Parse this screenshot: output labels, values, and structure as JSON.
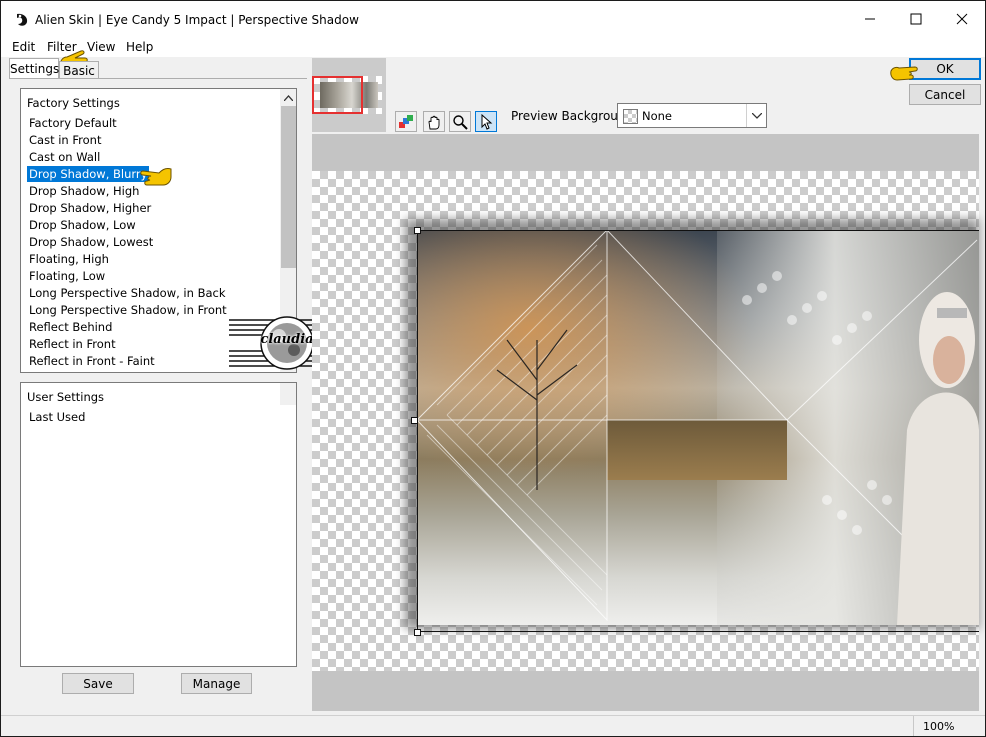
{
  "window": {
    "title": "Alien Skin | Eye Candy 5 Impact | Perspective Shadow"
  },
  "menu": {
    "items": [
      "Edit",
      "Filter",
      "View",
      "Help"
    ]
  },
  "tabs": {
    "settings": "Settings",
    "basic": "Basic"
  },
  "factory": {
    "header": "Factory Settings",
    "items": [
      "Factory Default",
      "Cast in Front",
      "Cast on Wall",
      "Drop Shadow, Blurry",
      "Drop Shadow, High",
      "Drop Shadow, Higher",
      "Drop Shadow, Low",
      "Drop Shadow, Lowest",
      "Floating, High",
      "Floating, Low",
      "Long Perspective Shadow, in Back",
      "Long Perspective Shadow, in Front",
      "Reflect Behind",
      "Reflect in Front",
      "Reflect in Front - Faint"
    ],
    "selected": "Drop Shadow, Blurry"
  },
  "user": {
    "header": "User Settings",
    "items": [
      "Last Used"
    ]
  },
  "buttons": {
    "save": "Save",
    "manage": "Manage",
    "ok": "OK",
    "cancel": "Cancel"
  },
  "preview": {
    "background_label": "Preview Background:",
    "background_value": "None"
  },
  "watermark": {
    "text": "claudia"
  },
  "status": {
    "zoom": "100%"
  },
  "colors": {
    "selection": "#0078d7",
    "pointer_hand": "#f5c400",
    "thumb_frame": "#e53030"
  },
  "icons": [
    "app-icon",
    "minimize-icon",
    "maximize-icon",
    "close-icon",
    "pointing-hand-icon",
    "scroll-up-icon",
    "dropdown-chevron-icon",
    "hand-tool-icon",
    "zoom-tool-icon",
    "arrow-tool-icon",
    "color-picker-icon"
  ]
}
